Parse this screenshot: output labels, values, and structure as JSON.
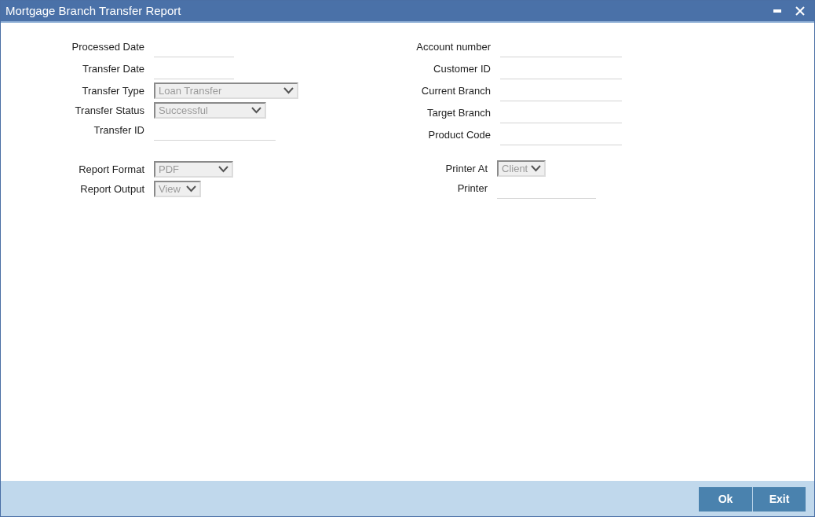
{
  "window": {
    "title": "Mortgage Branch Transfer Report"
  },
  "left_fields": [
    {
      "label": "Processed Date",
      "kind": "text"
    },
    {
      "label": "Transfer Date",
      "kind": "text"
    },
    {
      "label": "Transfer Type",
      "kind": "select",
      "value": "Loan Transfer",
      "disabled": true
    },
    {
      "label": "Transfer Status",
      "kind": "select",
      "value": "Successful",
      "disabled": true
    },
    {
      "label": "Transfer ID",
      "kind": "text"
    }
  ],
  "right_fields": [
    {
      "label": "Account number",
      "kind": "text"
    },
    {
      "label": "Customer ID",
      "kind": "text"
    },
    {
      "label": "Current Branch",
      "kind": "text"
    },
    {
      "label": "Target Branch",
      "kind": "text"
    },
    {
      "label": "Product Code",
      "kind": "text"
    }
  ],
  "report_left": [
    {
      "label": "Report Format",
      "kind": "select",
      "value": "PDF",
      "disabled": true
    },
    {
      "label": "Report Output",
      "kind": "select",
      "value": "View",
      "disabled": true
    }
  ],
  "report_right": [
    {
      "label": "Printer At",
      "kind": "select",
      "value": "Client",
      "disabled": true
    },
    {
      "label": "Printer",
      "kind": "text"
    }
  ],
  "buttons": [
    "Ok",
    "Exit"
  ]
}
